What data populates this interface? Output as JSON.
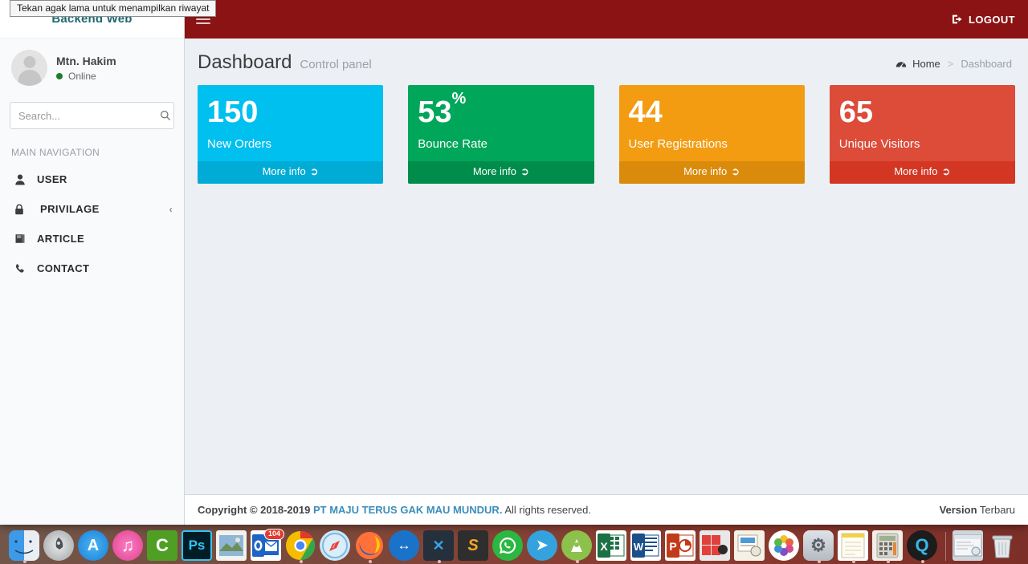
{
  "tooltip": {
    "text": "Tekan agak lama untuk menampilkan riwayat"
  },
  "sidebar": {
    "logo": "Backend Web",
    "user": {
      "name": "Mtn. Hakim",
      "status": "Online",
      "avatar_icon": "user-avatar-icon"
    },
    "search": {
      "placeholder": "Search...",
      "value": "",
      "icon": "search-icon"
    },
    "nav_header": "MAIN NAVIGATION",
    "items": [
      {
        "label": "USER",
        "icon": "user-icon",
        "caret": ""
      },
      {
        "label": "PRIVILAGE",
        "icon": "lock-icon",
        "caret": "‹"
      },
      {
        "label": "ARTICLE",
        "icon": "book-icon",
        "caret": ""
      },
      {
        "label": "CONTACT",
        "icon": "phone-icon",
        "caret": ""
      }
    ]
  },
  "topbar": {
    "menu_toggle_icon": "hamburger-icon",
    "logout_label": "LOGOUT",
    "logout_icon": "sign-out-icon",
    "bg_color": "#8b1313"
  },
  "content": {
    "title": "Dashboard",
    "subtitle": "Control panel",
    "breadcrumb": {
      "icon": "dashboard-icon",
      "home": "Home",
      "separator": ">",
      "current": "Dashboard"
    },
    "boxes": [
      {
        "number": "150",
        "suffix": "",
        "label": "New Orders",
        "footer": "More info",
        "footer_icon": "circle-arrow-right-icon",
        "color": "#00c0ef",
        "footer_color": "#00acd6"
      },
      {
        "number": "53",
        "suffix": "%",
        "label": "Bounce Rate",
        "footer": "More info",
        "footer_icon": "circle-arrow-right-icon",
        "color": "#00a65a",
        "footer_color": "#008d4c"
      },
      {
        "number": "44",
        "suffix": "",
        "label": "User Registrations",
        "footer": "More info",
        "footer_icon": "circle-arrow-right-icon",
        "color": "#f39c12",
        "footer_color": "#db8b0b"
      },
      {
        "number": "65",
        "suffix": "",
        "label": "Unique Visitors",
        "footer": "More info",
        "footer_icon": "circle-arrow-right-icon",
        "color": "#dd4b39",
        "footer_color": "#d33724"
      }
    ]
  },
  "footer": {
    "copyright_bold": "Copyright © 2018-2019",
    "company": "PT MAJU TERUS GAK MAU MUNDUR.",
    "rights": "All rights reserved.",
    "version_label": "Version",
    "version_value": "Terbaru"
  },
  "dock": {
    "items": [
      {
        "name": "finder",
        "glyph": "",
        "running": true
      },
      {
        "name": "launchpad",
        "glyph": "",
        "running": false
      },
      {
        "name": "app-store",
        "glyph": "A",
        "running": false
      },
      {
        "name": "itunes",
        "glyph": "♫",
        "running": false
      },
      {
        "name": "camtasia",
        "glyph": "C",
        "running": false
      },
      {
        "name": "photoshop",
        "glyph": "Ps",
        "running": false
      },
      {
        "name": "mail",
        "glyph": "",
        "running": false
      },
      {
        "name": "outlook",
        "glyph": "O",
        "running": false,
        "badge": "104"
      },
      {
        "name": "chrome",
        "glyph": "",
        "running": true
      },
      {
        "name": "safari",
        "glyph": "",
        "running": false
      },
      {
        "name": "firefox",
        "glyph": "",
        "running": true
      },
      {
        "name": "teamviewer",
        "glyph": "↔",
        "running": false
      },
      {
        "name": "vscode",
        "glyph": "✕",
        "running": true
      },
      {
        "name": "sublime-text",
        "glyph": "S",
        "running": false
      },
      {
        "name": "whatsapp",
        "glyph": "✆",
        "running": false
      },
      {
        "name": "telegram",
        "glyph": "➤",
        "running": false
      },
      {
        "name": "android-studio",
        "glyph": "A",
        "running": true
      },
      {
        "name": "excel",
        "glyph": "X",
        "running": false
      },
      {
        "name": "word",
        "glyph": "W",
        "running": false
      },
      {
        "name": "powerpoint",
        "glyph": "P",
        "running": false
      },
      {
        "name": "photo-booth",
        "glyph": "",
        "running": false
      },
      {
        "name": "preview",
        "glyph": "",
        "running": false
      },
      {
        "name": "photos",
        "glyph": "",
        "running": false
      },
      {
        "name": "system-preferences",
        "glyph": "⚙",
        "running": true
      },
      {
        "name": "notes",
        "glyph": "",
        "running": true
      },
      {
        "name": "calculator",
        "glyph": "",
        "running": true
      },
      {
        "name": "quicktime",
        "glyph": "Q",
        "running": true
      },
      {
        "name": "separator",
        "glyph": "",
        "running": false
      },
      {
        "name": "window-thumbnail",
        "glyph": "",
        "running": false
      },
      {
        "name": "trash",
        "glyph": "",
        "running": false
      }
    ]
  }
}
